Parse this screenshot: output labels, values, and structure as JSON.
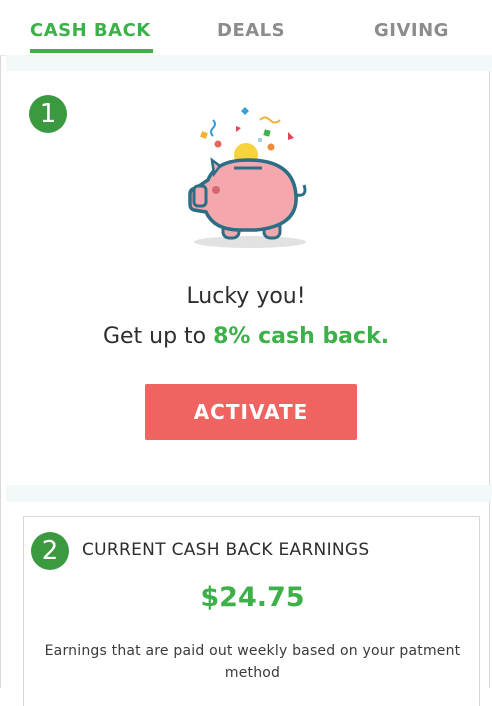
{
  "tabs": [
    {
      "label": "CASH BACK",
      "active": true
    },
    {
      "label": "DEALS",
      "active": false
    },
    {
      "label": "GIVING",
      "active": false
    }
  ],
  "section1": {
    "step_number": "1",
    "headline": "Lucky you!",
    "offer_prefix": "Get up to ",
    "offer_highlight": "8% cash back.",
    "activate_label": "ACTIVATE",
    "illustration_icon": "piggy-bank-icon"
  },
  "section2": {
    "step_number": "2",
    "title": "CURRENT CASH BACK EARNINGS",
    "amount": "$24.75",
    "note": "Earnings that are paid out weekly based on your patment method"
  },
  "colors": {
    "accent_green": "#3db049",
    "button_red": "#ef6461",
    "step_badge": "#3b9a3f"
  }
}
